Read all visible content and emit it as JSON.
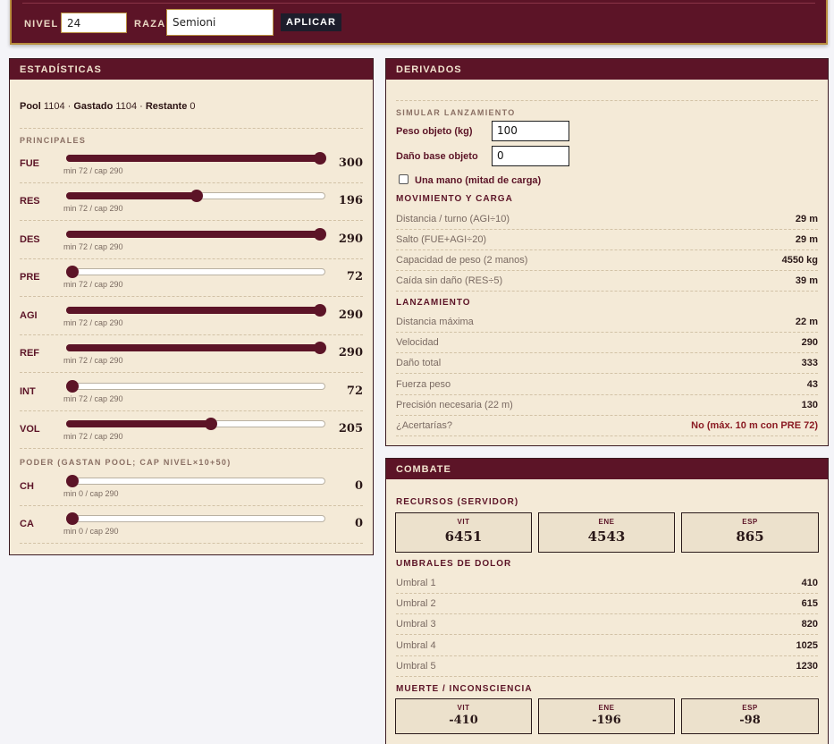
{
  "topbar": {
    "nivel_label": "NIVEL",
    "nivel_value": "24",
    "raza_label": "RAZA",
    "raza_value": "Semioni",
    "apply_label": "APLICAR"
  },
  "stats": {
    "title": "ESTADÍSTICAS",
    "pool_label": "Pool",
    "pool_value": "1104",
    "spent_label": "Gastado",
    "spent_value": "1104",
    "remaining_label": "Restante",
    "remaining_value": "0",
    "principal_title": "PRINCIPALES",
    "principal": [
      {
        "name": "FUE",
        "value": "300",
        "range": "min 72 / cap 290",
        "level": 1.0
      },
      {
        "name": "RES",
        "value": "196",
        "range": "min 72 / cap 290",
        "level": 0.5
      },
      {
        "name": "DES",
        "value": "290",
        "range": "min 72 / cap 290",
        "level": 1.0
      },
      {
        "name": "PRE",
        "value": "72",
        "range": "min 72 / cap 290",
        "level": 0.0
      },
      {
        "name": "AGI",
        "value": "290",
        "range": "min 72 / cap 290",
        "level": 1.0
      },
      {
        "name": "REF",
        "value": "290",
        "range": "min 72 / cap 290",
        "level": 1.0
      },
      {
        "name": "INT",
        "value": "72",
        "range": "min 72 / cap 290",
        "level": 0.0
      },
      {
        "name": "VOL",
        "value": "205",
        "range": "min 72 / cap 290",
        "level": 0.56
      }
    ],
    "power_title": "PODER (GASTAN POOL; CAP NIVEL×10+50)",
    "power": [
      {
        "name": "CH",
        "value": "0",
        "range": "min 0 / cap 290",
        "level": 0.0
      },
      {
        "name": "CA",
        "value": "0",
        "range": "min 0 / cap 290",
        "level": 0.0
      }
    ]
  },
  "derived": {
    "title": "DERIVADOS",
    "simulate_title": "SIMULAR LANZAMIENTO",
    "weight_label": "Peso objeto (kg)",
    "weight_value": "100",
    "damage_label": "Daño base objeto",
    "damage_value": "0",
    "onehand_label": "Una mano (mitad de carga)",
    "movement_title": "MOVIMIENTO Y CARGA",
    "movement": [
      {
        "label": "Distancia / turno (AGI÷10)",
        "value": "29 m"
      },
      {
        "label": "Salto (FUE+AGI÷20)",
        "value": "29 m"
      },
      {
        "label": "Capacidad de peso (2 manos)",
        "value": "4550 kg"
      },
      {
        "label": "Caída sin daño (RES÷5)",
        "value": "39 m"
      }
    ],
    "launch_title": "LANZAMIENTO",
    "launch": [
      {
        "label": "Distancia máxima",
        "value": "22 m"
      },
      {
        "label": "Velocidad",
        "value": "290"
      },
      {
        "label": "Daño total",
        "value": "333"
      },
      {
        "label": "Fuerza peso",
        "value": "43"
      },
      {
        "label": "Precisión necesaria (22 m)",
        "value": "130"
      },
      {
        "label": "¿Acertarías?",
        "value": "No (máx. 10 m con PRE 72)"
      }
    ]
  },
  "combat": {
    "title": "COMBATE",
    "resources_title": "RECURSOS (SERVIDOR)",
    "resources": [
      {
        "label": "VIT",
        "value": "6451"
      },
      {
        "label": "ENE",
        "value": "4543"
      },
      {
        "label": "ESP",
        "value": "865"
      }
    ],
    "pain_title": "UMBRALES DE DOLOR",
    "pain": [
      {
        "label": "Umbral 1",
        "value": "410"
      },
      {
        "label": "Umbral 2",
        "value": "615"
      },
      {
        "label": "Umbral 3",
        "value": "820"
      },
      {
        "label": "Umbral 4",
        "value": "1025"
      },
      {
        "label": "Umbral 5",
        "value": "1230"
      }
    ],
    "death_title": "MUERTE / INCONSCIENCIA",
    "death": [
      {
        "label": "VIT",
        "value": "-410"
      },
      {
        "label": "ENE",
        "value": "-196"
      },
      {
        "label": "ESP",
        "value": "-98"
      }
    ]
  },
  "colors": {
    "primary": "#5c1427",
    "panel_bg": "#f4ead7",
    "accent_gold": "#b98f3f",
    "alert_red": "#8a1a22"
  }
}
